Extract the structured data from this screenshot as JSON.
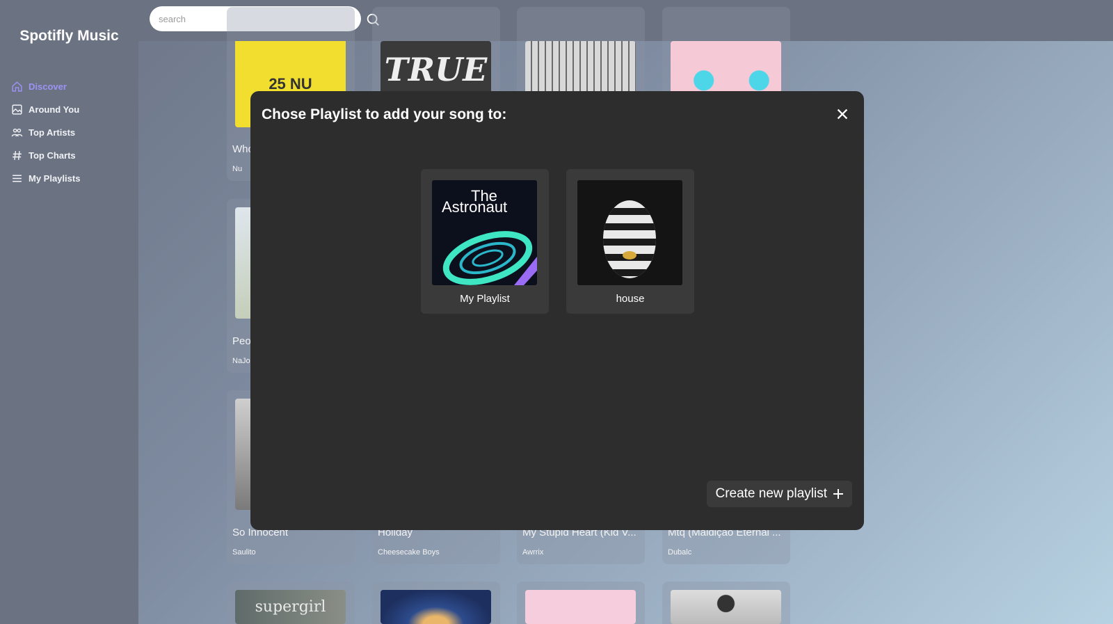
{
  "app": {
    "title": "Spotifly Music"
  },
  "sidebar": {
    "items": [
      {
        "label": "Discover",
        "icon": "home-icon",
        "active": true
      },
      {
        "label": "Around You",
        "icon": "image-icon"
      },
      {
        "label": "Top Artists",
        "icon": "users-icon"
      },
      {
        "label": "Top Charts",
        "icon": "hash-icon"
      },
      {
        "label": "My Playlists",
        "icon": "list-icon"
      }
    ]
  },
  "search": {
    "placeholder": "search",
    "value": ""
  },
  "songs": [
    {
      "title": "Who",
      "artist": "Nu",
      "cover_text": "25 NU"
    },
    {
      "title": "Peo",
      "artist": "NaJo"
    },
    {
      "title": "So Innocent",
      "artist": "Saulito"
    },
    {
      "title": "Holiday",
      "artist": "Cheesecake Boys"
    },
    {
      "title": "My Stupid Heart (Kid V...",
      "artist": "Awrrix"
    },
    {
      "title": "Mtq (Maldição Eternal ...",
      "artist": "Dubalc"
    },
    {
      "title": "",
      "artist": "",
      "cover_text": "TRUE"
    },
    {
      "title": "",
      "artist": "",
      "cover_text": "supergirl"
    }
  ],
  "modal": {
    "title": "Chose Playlist to add your song to:",
    "close_icon": "close-icon",
    "playlists": [
      {
        "name": "My Playlist",
        "cover_text_1": "The",
        "cover_text_2": "Astronaut"
      },
      {
        "name": "house"
      }
    ],
    "create_label": "Create new playlist"
  },
  "colors": {
    "sidebar": "#6b7282",
    "accent": "#9b94f5",
    "modal_bg": "#2d2d2d",
    "card_bg": "#3a3a3a"
  }
}
